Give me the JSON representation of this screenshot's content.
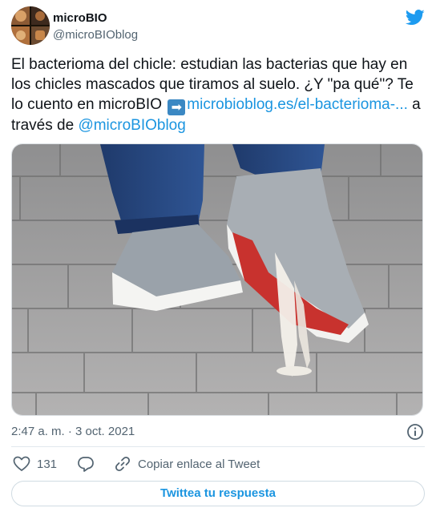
{
  "author": {
    "display_name": "microBIO",
    "handle": "@microBIOblog",
    "avatar_icon": "avatar-photo-collage"
  },
  "brand": {
    "logo_icon": "twitter-bird-icon",
    "logo_color": "#1d9bf0"
  },
  "tweet": {
    "text_1": "El bacterioma del chicle: estudian las bacterias que hay en los chicles mascados que tiramos al suelo. ¿Y \"pa qué\"? Te lo cuento en microBIO ",
    "arrow_emoji": "➡",
    "link_text": "microbioblog.es/el-bacterioma-...",
    "text_2": " a través de ",
    "mention": "@microBIOblog",
    "link_color": "#1b95e0"
  },
  "media": {
    "image_icon": "photo-sneaker-stepping-on-gum"
  },
  "meta": {
    "timestamp": "2:47 a. m. · 3 oct. 2021",
    "info_icon": "info-circle-icon"
  },
  "actions": {
    "like_count": "131",
    "copy_link_label": "Copiar enlace al Tweet"
  },
  "reply_button": {
    "label": "Twittea tu respuesta"
  }
}
